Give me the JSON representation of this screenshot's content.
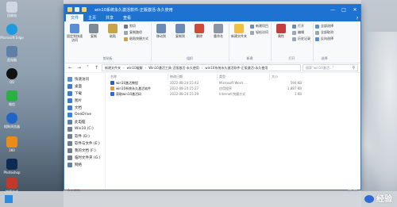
{
  "desktop": {
    "icons": [
      {
        "label": "回收站",
        "color": "#cfd8e2"
      },
      {
        "label": "Microsoft Edge",
        "color": "#1f9ae0"
      },
      {
        "label": "此电脑",
        "color": "#5e7fa8"
      },
      {
        "label": "QQ",
        "color": "#111111"
      },
      {
        "label": "微信",
        "color": "#2bb143"
      },
      {
        "label": "搜狗浏览器",
        "color": "#1f64c8"
      },
      {
        "label": "360",
        "color": "#e98c1a"
      },
      {
        "label": "Photoshop",
        "color": "#0d2b52"
      },
      {
        "label": "快捷方式",
        "color": "#c0392b"
      }
    ],
    "watermark": "经验"
  },
  "window": {
    "title": "win10系统永久激活软件-正版激活-永久使用",
    "tabs": [
      "文件",
      "主页",
      "共享",
      "查看"
    ],
    "help": "?",
    "ribbon": {
      "groups": [
        {
          "name": "剪贴板",
          "big": [
            {
              "label": "固定到快速访问",
              "color": "#5a8fd6"
            },
            {
              "label": "复制",
              "color": "#7d8b99"
            },
            {
              "label": "粘贴",
              "color": "#c9a34a"
            }
          ],
          "small": [
            "剪切",
            "复制路径",
            "粘贴快捷方式"
          ]
        },
        {
          "name": "组织",
          "big": [
            {
              "label": "移动到",
              "color": "#6b8bb5"
            },
            {
              "label": "复制到",
              "color": "#6b8bb5"
            },
            {
              "label": "删除",
              "color": "#d04a3a"
            },
            {
              "label": "重命名",
              "color": "#8a96a3"
            }
          ],
          "small": []
        },
        {
          "name": "新建",
          "big": [
            {
              "label": "新建文件夹",
              "color": "#f0c040"
            }
          ],
          "small": [
            "新建项目",
            "轻松访问"
          ]
        },
        {
          "name": "打开",
          "big": [
            {
              "label": "属性",
              "color": "#c43d3d"
            }
          ],
          "small": [
            "打开",
            "编辑",
            "历史记录"
          ]
        },
        {
          "name": "选择",
          "big": [],
          "small": [
            "全部选择",
            "全部取消",
            "反向选择"
          ]
        }
      ]
    },
    "address": {
      "crumbs": [
        "新建文件夹",
        "win10破解",
        "Win10激活工具-正版激活-永久使用",
        "win10系统永久激活软件-正版激活-永久使用"
      ],
      "search_placeholder": "搜索\"win10激活...\""
    },
    "nav": [
      {
        "label": "快速访问",
        "color": "#5a8fd6"
      },
      {
        "label": "桌面",
        "color": "#3b7bd0"
      },
      {
        "label": "下载",
        "color": "#3b7bd0"
      },
      {
        "label": "图片",
        "color": "#3b7bd0"
      },
      {
        "label": "文档",
        "color": "#3b7bd0"
      },
      {
        "label": "OneDrive",
        "color": "#2e86de"
      },
      {
        "label": "此电脑",
        "color": "#5e7fa8"
      },
      {
        "label": "Win10 (C:)",
        "color": "#6f7d8c"
      },
      {
        "label": "软件 (D:)",
        "color": "#6f7d8c"
      },
      {
        "label": "软件与文件 (E:)",
        "color": "#6f7d8c"
      },
      {
        "label": "我的文档 (F:)",
        "color": "#6f7d8c"
      },
      {
        "label": "临时文件夹 (G:)",
        "color": "#6f7d8c"
      },
      {
        "label": "网络",
        "color": "#5e7fa8"
      }
    ],
    "columns": [
      "名称",
      "修改日期",
      "类型",
      "大小"
    ],
    "files": [
      {
        "name": "win10激活教程",
        "date": "2022-08-24 15:43",
        "type": "Microsoft Word ...",
        "size": "594 KB",
        "color": "#2b5fb3"
      },
      {
        "name": "win10系统永久激活软件",
        "date": "2022-08-24 15:27",
        "type": "应用程序",
        "size": "1,887 KB",
        "color": "#e0a030"
      },
      {
        "name": "获取win10激活码",
        "date": "2022-08-24 15:29",
        "type": "Internet 快捷方式",
        "size": "1 KB",
        "color": "#2f6ad0"
      }
    ],
    "status": "3 个项目"
  }
}
